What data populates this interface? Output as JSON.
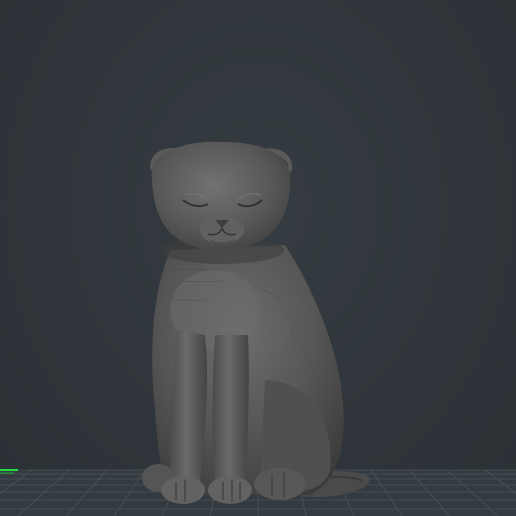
{
  "viewport": {
    "background_color": "#2f353a",
    "model": "cat-figurine",
    "model_color": "#5c5c5c",
    "grid_color": "#4a5358",
    "axis_x_color": "#ff3b30",
    "axis_y_color": "#22e040"
  }
}
